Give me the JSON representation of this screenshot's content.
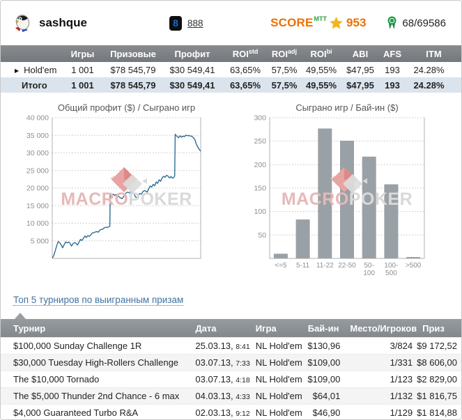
{
  "profile": {
    "username": "sashque",
    "room": {
      "badge": "8",
      "link_label": "888"
    },
    "score": {
      "label": "SCORE",
      "sup": "MTT",
      "value": "953"
    },
    "rank": {
      "value": "68/69586"
    }
  },
  "colors": {
    "accent_orange": "#ee7000",
    "sup_green": "#2f9e3f",
    "star_gold": "#f2b616",
    "medal_green": "#1f9e4c",
    "profit_green": "#2ca577",
    "link_blue": "#3f72a3",
    "stats_header_gray": "#7d8286",
    "tours_header_gray": "#8b9195",
    "total_row_bg": "#dbe4ed",
    "line_blue": "#2d6e96",
    "bar_gray": "#9aa1a6"
  },
  "stats_table": {
    "headers": [
      {
        "text": "",
        "sup": ""
      },
      {
        "text": "Игры",
        "sup": ""
      },
      {
        "text": "Призовые",
        "sup": ""
      },
      {
        "text": "Профит",
        "sup": ""
      },
      {
        "text": "ROI",
        "sup": "std"
      },
      {
        "text": "ROI",
        "sup": "adj"
      },
      {
        "text": "ROI",
        "sup": "bi"
      },
      {
        "text": "ABI",
        "sup": ""
      },
      {
        "text": "AFS",
        "sup": ""
      },
      {
        "text": "ITM",
        "sup": ""
      }
    ],
    "rows": [
      {
        "expander": "▶",
        "name": "Hold'em",
        "games": "1 001",
        "prizes": "$78 545,79",
        "profit": "$30 549,41",
        "roi_std": "63,65%",
        "roi_adj": "57,5%",
        "roi_bi": "49,55%",
        "abi": "$47,95",
        "afs": "193",
        "itm": "24.28%"
      },
      {
        "expander": "",
        "name": "Итого",
        "games": "1 001",
        "prizes": "$78 545,79",
        "profit": "$30 549,41",
        "roi_std": "63,65%",
        "roi_adj": "57,5%",
        "roi_bi": "49,55%",
        "abi": "$47,95",
        "afs": "193",
        "itm": "24.28%"
      }
    ]
  },
  "watermark": {
    "text_left": "MACRO",
    "text_right": "POKER"
  },
  "chart_data": [
    {
      "type": "line",
      "title": "Общий профит ($) / Сыграно игр",
      "xlabel": "",
      "ylabel": "",
      "ylim": [
        0,
        40000
      ],
      "ytick": 5000,
      "grid": true,
      "legend": "none",
      "line_color": "#2d6e96",
      "x_is_games_played": [
        0,
        1001
      ],
      "points": [
        [
          0,
          100
        ],
        [
          0.01,
          800
        ],
        [
          0.02,
          2200
        ],
        [
          0.03,
          3600
        ],
        [
          0.04,
          4800
        ],
        [
          0.05,
          4500
        ],
        [
          0.06,
          3800
        ],
        [
          0.07,
          3000
        ],
        [
          0.08,
          3900
        ],
        [
          0.09,
          4700
        ],
        [
          0.1,
          4400
        ],
        [
          0.11,
          4650
        ],
        [
          0.12,
          4300
        ],
        [
          0.13,
          3500
        ],
        [
          0.14,
          4200
        ],
        [
          0.15,
          4500
        ],
        [
          0.16,
          4300
        ],
        [
          0.17,
          3800
        ],
        [
          0.18,
          4600
        ],
        [
          0.19,
          5400
        ],
        [
          0.2,
          5100
        ],
        [
          0.21,
          5700
        ],
        [
          0.22,
          6400
        ],
        [
          0.23,
          5950
        ],
        [
          0.24,
          6500
        ],
        [
          0.25,
          6300
        ],
        [
          0.26,
          6700
        ],
        [
          0.27,
          7250
        ],
        [
          0.28,
          7350
        ],
        [
          0.29,
          7500
        ],
        [
          0.3,
          7650
        ],
        [
          0.31,
          7450
        ],
        [
          0.32,
          8000
        ],
        [
          0.33,
          8250
        ],
        [
          0.34,
          8300
        ],
        [
          0.35,
          8700
        ],
        [
          0.36,
          8850
        ],
        [
          0.37,
          8800
        ],
        [
          0.38,
          9000
        ],
        [
          0.388,
          9100
        ],
        [
          0.39,
          18300
        ],
        [
          0.4,
          18100
        ],
        [
          0.41,
          18250
        ],
        [
          0.42,
          17900
        ],
        [
          0.43,
          18150
        ],
        [
          0.44,
          17850
        ],
        [
          0.45,
          17500
        ],
        [
          0.46,
          17200
        ],
        [
          0.47,
          17000
        ],
        [
          0.48,
          17500
        ],
        [
          0.49,
          18300
        ],
        [
          0.5,
          18700
        ],
        [
          0.51,
          18850
        ],
        [
          0.52,
          18600
        ],
        [
          0.53,
          19050
        ],
        [
          0.54,
          18800
        ],
        [
          0.55,
          18550
        ],
        [
          0.56,
          17450
        ],
        [
          0.57,
          17300
        ],
        [
          0.58,
          17900
        ],
        [
          0.59,
          18450
        ],
        [
          0.6,
          18250
        ],
        [
          0.61,
          18950
        ],
        [
          0.62,
          19300
        ],
        [
          0.63,
          19100
        ],
        [
          0.64,
          18850
        ],
        [
          0.65,
          19850
        ],
        [
          0.66,
          20600
        ],
        [
          0.67,
          20250
        ],
        [
          0.68,
          21050
        ],
        [
          0.69,
          20650
        ],
        [
          0.7,
          21750
        ],
        [
          0.71,
          21350
        ],
        [
          0.72,
          22350
        ],
        [
          0.73,
          21950
        ],
        [
          0.74,
          22850
        ],
        [
          0.75,
          23350
        ],
        [
          0.76,
          23050
        ],
        [
          0.77,
          23650
        ],
        [
          0.78,
          23400
        ],
        [
          0.79,
          22850
        ],
        [
          0.8,
          23300
        ],
        [
          0.81,
          22800
        ],
        [
          0.82,
          23100
        ],
        [
          0.825,
          23450
        ],
        [
          0.828,
          35300
        ],
        [
          0.84,
          34700
        ],
        [
          0.85,
          34300
        ],
        [
          0.86,
          34850
        ],
        [
          0.87,
          34450
        ],
        [
          0.88,
          34750
        ],
        [
          0.89,
          34600
        ],
        [
          0.9,
          35050
        ],
        [
          0.91,
          34900
        ],
        [
          0.92,
          34950
        ],
        [
          0.93,
          34800
        ],
        [
          0.94,
          34750
        ],
        [
          0.95,
          34350
        ],
        [
          0.96,
          33850
        ],
        [
          0.97,
          32600
        ],
        [
          0.98,
          31700
        ],
        [
          0.99,
          31000
        ],
        [
          1,
          30500
        ]
      ]
    },
    {
      "type": "bar",
      "title": "Сыграно игр / Бай-ин ($)",
      "xlabel": "",
      "ylabel": "",
      "ylim": [
        0,
        300
      ],
      "ytick": 50,
      "grid": true,
      "legend": "none",
      "bar_color": "#9aa1a6",
      "categories": [
        "<=5",
        "5-11",
        "11-22",
        "22-50",
        "50-100",
        "100-500",
        ">500"
      ],
      "category_lines": [
        [
          "<=5"
        ],
        [
          "5-11"
        ],
        [
          "11-22"
        ],
        [
          "22-50"
        ],
        [
          "50-",
          "100"
        ],
        [
          "100-",
          "500"
        ],
        [
          ">500"
        ]
      ],
      "values": [
        10,
        83,
        277,
        251,
        217,
        158,
        3
      ]
    }
  ],
  "top_link": {
    "label": "Топ 5 турниров по выигранным призам"
  },
  "tournaments": {
    "headers": [
      "Турнир",
      "Дата",
      "Игра",
      "Бай-ин",
      "Место/Игроков",
      "Приз"
    ],
    "rows": [
      {
        "name": "$100,000 Sunday Challenge 1R",
        "date": "25.03.13,",
        "time": "8:41",
        "game": "NL Hold'em",
        "buyin": "$130,96",
        "place": "3/824",
        "prize": "$9 172,52"
      },
      {
        "name": "$30,000 Tuesday High-Rollers Challenge",
        "date": "03.07.13,",
        "time": "7:33",
        "game": "NL Hold'em",
        "buyin": "$109,00",
        "place": "1/331",
        "prize": "$8 606,00"
      },
      {
        "name": "The $10,000 Tornado",
        "date": "03.07.13,",
        "time": "4:18",
        "game": "NL Hold'em",
        "buyin": "$109,00",
        "place": "1/123",
        "prize": "$2 829,00"
      },
      {
        "name": "The $5,000 Thunder 2nd Chance - 6 max",
        "date": "04.03.13,",
        "time": "4:33",
        "game": "NL Hold'em",
        "buyin": "$64,01",
        "place": "1/132",
        "prize": "$1 816,75"
      },
      {
        "name": "$4,000 Guaranteed Turbo R&A",
        "date": "02.03.13,",
        "time": "9:12",
        "game": "NL Hold'em",
        "buyin": "$46,90",
        "place": "1/129",
        "prize": "$1 814,88"
      }
    ]
  }
}
